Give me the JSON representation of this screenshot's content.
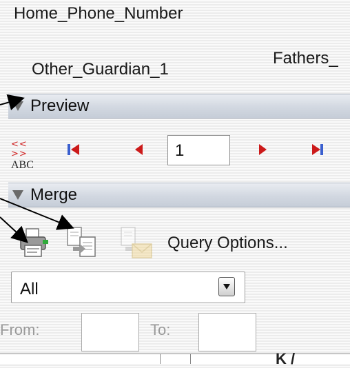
{
  "fields": {
    "home_phone": "Home_Phone_Number",
    "other_guardian": "Other_Guardian_1",
    "fathers": "Fathers_"
  },
  "preview": {
    "label": "Preview",
    "abc_top": "<< >>",
    "abc_bottom": "ABC",
    "record": "1"
  },
  "merge": {
    "label": "Merge",
    "query_options": "Query Options...",
    "records_select": "All",
    "from_label": "From:",
    "to_label": "To:",
    "from_value": "",
    "to_value": ""
  },
  "bottom": {
    "cell_text": "K /"
  },
  "colors": {
    "nav_red": "#cc1a1a",
    "nav_blue": "#3a5fcf",
    "header_blue": "#cfd6e0"
  }
}
